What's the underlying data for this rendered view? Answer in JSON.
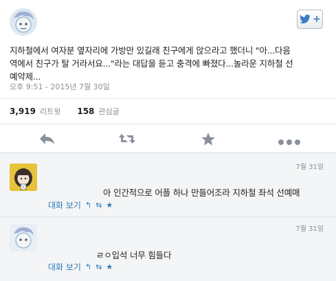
{
  "tweet": {
    "text_line1": "지하철에서 여자분 옆자리에 가방만 있길래 친구에게 앉으라고 했더니 \"아...다음",
    "text_line2": "역에서 친구가 탈 거라서요...\"라는 대답을 듣고 충격에 빠졌다...놀라운 지하철 선",
    "text_line3": "예약제...",
    "timestamp": "오후 9:51 - 2015년 7월 30일",
    "retweet_count": "3,919",
    "retweet_label": "리트윗",
    "favorite_count": "158",
    "favorite_label": "관심글"
  },
  "icons": {
    "follow": "twitter-bird-plus-icon",
    "reply": "reply-arrow-icon",
    "retweet": "retweet-icon",
    "favorite": "star-icon",
    "more": "more-dots-icon"
  },
  "replies": [
    {
      "date": "7월 31일",
      "text": "아 인간적으로 어플 하나 만들어조라 지하철 좌석 선예매",
      "conversation_link": "대화 보기"
    },
    {
      "date": "7월 31일",
      "text": "ㄹㅇ입석 너무 힘들다",
      "conversation_link": "대화 보기"
    }
  ],
  "colors": {
    "accent": "#2b7bb9",
    "icon_gray": "#8a9099",
    "muted_text": "#8a8f94"
  }
}
